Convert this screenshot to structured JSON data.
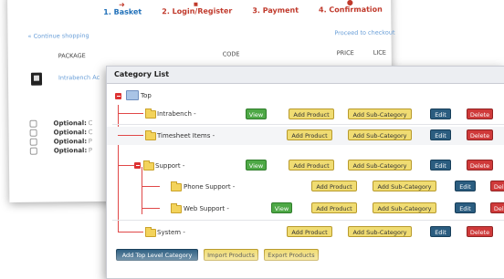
{
  "checkout": {
    "steps": [
      {
        "label": "1. Basket"
      },
      {
        "label": "2. Login/Register"
      },
      {
        "label": "3. Payment"
      },
      {
        "label": "4. Confirmation"
      }
    ],
    "continue_link": "« Continue shopping",
    "proceed_link": "Proceed to checkout",
    "columns": {
      "package": "PACKAGE",
      "code": "CODE",
      "price": "PRICE",
      "licence": "LICE"
    },
    "package_name": "Intrabench Ac",
    "optional_label": "Optional:",
    "optional_rows": [
      "C",
      "C",
      "P",
      "P"
    ]
  },
  "category_list": {
    "title": "Category List",
    "root_label": "Top",
    "buttons": {
      "view": "View",
      "add_product": "Add Product",
      "add_sub_category": "Add Sub-Category",
      "edit": "Edit",
      "delete": "Delete"
    },
    "categories": [
      {
        "label": "Intrabench -"
      },
      {
        "label": "Timesheet Items -"
      },
      {
        "label": "Support -"
      },
      {
        "label": "Phone Support -"
      },
      {
        "label": "Web Support -"
      },
      {
        "label": "System -"
      }
    ],
    "bottom_buttons": {
      "add_top_level": "Add Top Level Category",
      "import": "Import Products",
      "export": "Export Products"
    }
  },
  "colors": {
    "view": "#4ea846",
    "add": "#f0dc72",
    "edit": "#2b5d80",
    "delete": "#cf3a3a",
    "tree_line": "#e04848"
  }
}
